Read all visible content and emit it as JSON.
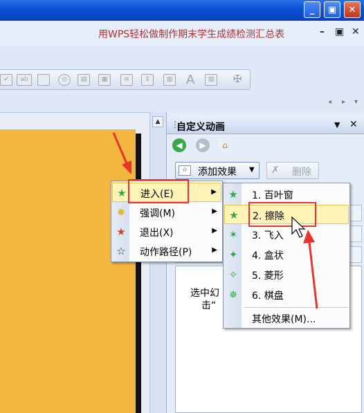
{
  "window": {
    "minimize_glyph": "_",
    "restore_glyph": "▣",
    "close_glyph": "✕"
  },
  "document": {
    "title": "用WPS轻松做制作期末学生成绩检测汇总表",
    "controls": [
      "–",
      "▣",
      "✕"
    ]
  },
  "task_pane": {
    "title": "自定义动画",
    "add_effect_label": "添加效果",
    "delete_label": "删除",
    "hint_line1": "选中幻",
    "hint_line2": "击“"
  },
  "menu_main": {
    "items": [
      {
        "label": "进入(E)",
        "icon": "star-green-icon",
        "highlighted": true
      },
      {
        "label": "强调(M)",
        "icon": "star-yellow-icon",
        "highlighted": false
      },
      {
        "label": "退出(X)",
        "icon": "star-red-icon",
        "highlighted": false
      },
      {
        "label": "动作路径(P)",
        "icon": "star-outline-icon",
        "highlighted": false
      }
    ]
  },
  "menu_sub": {
    "items": [
      {
        "label": "1. 百叶窗",
        "highlighted": false
      },
      {
        "label": "2. 擦除",
        "highlighted": true
      },
      {
        "label": "3. 飞入",
        "highlighted": false
      },
      {
        "label": "4. 盒状",
        "highlighted": false
      },
      {
        "label": "5. 菱形",
        "highlighted": false
      },
      {
        "label": "6. 棋盘",
        "highlighted": false
      }
    ],
    "more_effects": "其他效果(M)..."
  },
  "colors": {
    "titlebar": "#0a54d8",
    "slide": "#f2b740",
    "highlight": "#fff3b8",
    "annotation_red": "#e8332a"
  }
}
